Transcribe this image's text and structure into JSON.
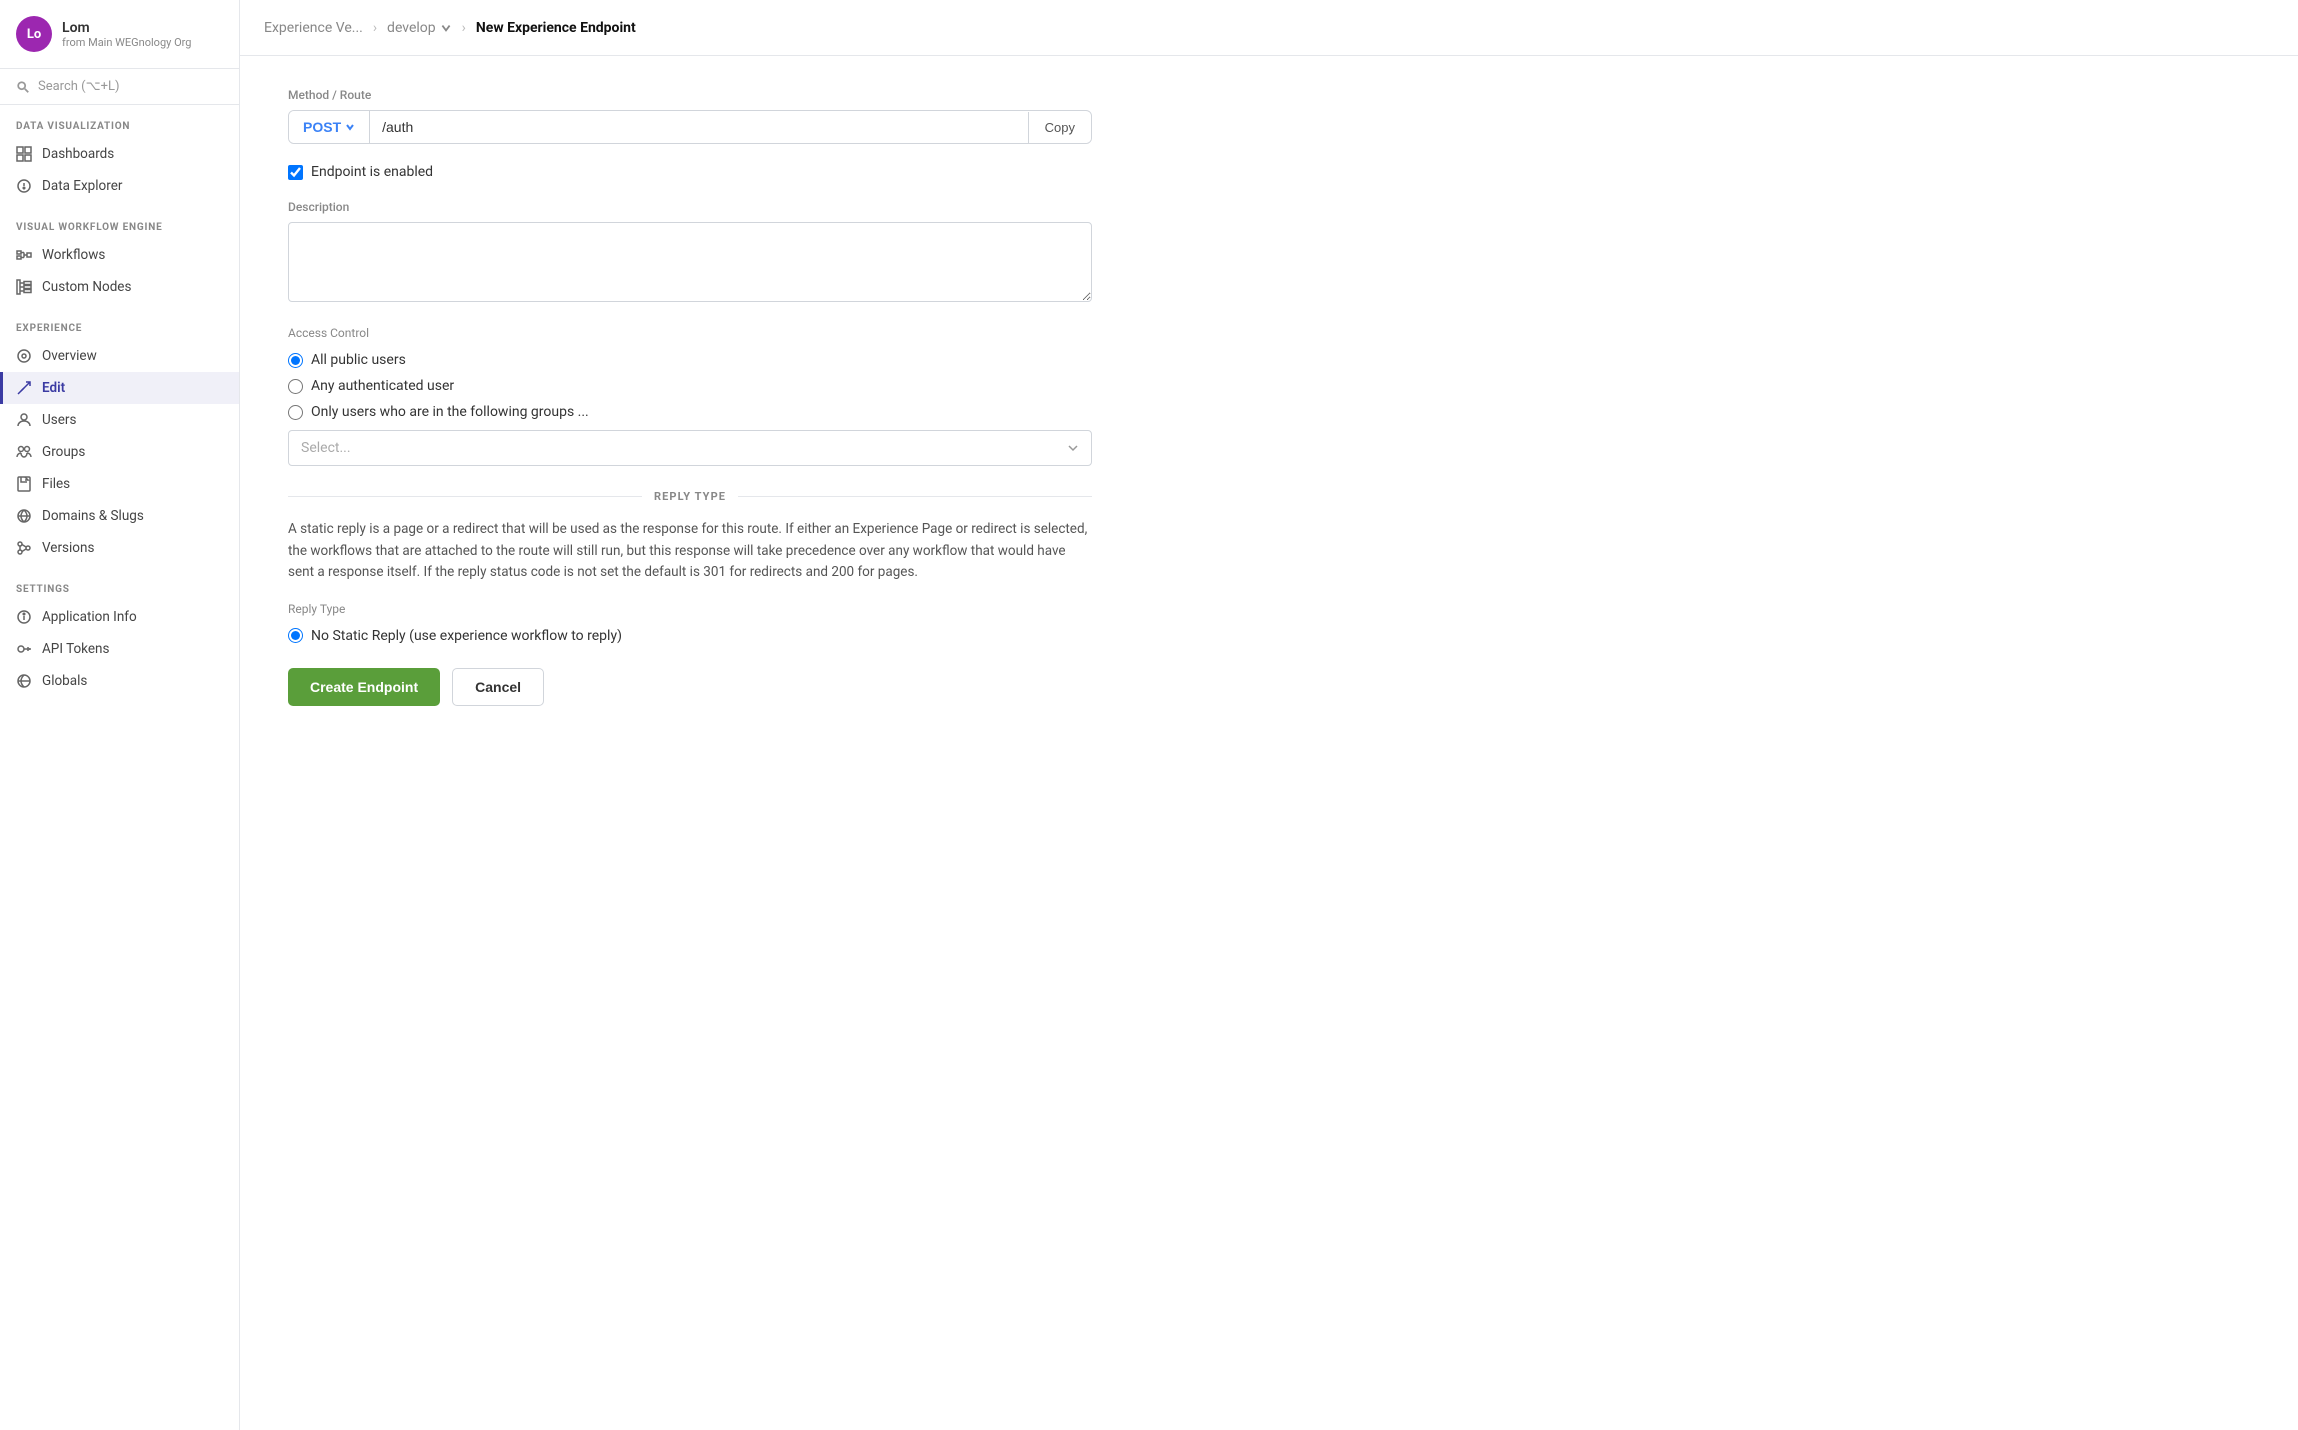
{
  "user": {
    "initials": "Lo",
    "name": "Lom",
    "org": "from Main WEGnology Org"
  },
  "search": {
    "placeholder": "Search (⌥+L)"
  },
  "sidebar": {
    "sections": [
      {
        "label": "DATA VISUALIZATION",
        "items": [
          {
            "id": "dashboards",
            "label": "Dashboards",
            "icon": "grid-icon"
          },
          {
            "id": "data-explorer",
            "label": "Data Explorer",
            "icon": "circle-icon"
          }
        ]
      },
      {
        "label": "VISUAL WORKFLOW ENGINE",
        "items": [
          {
            "id": "workflows",
            "label": "Workflows",
            "icon": "workflow-icon"
          },
          {
            "id": "custom-nodes",
            "label": "Custom Nodes",
            "icon": "nodes-icon"
          }
        ]
      },
      {
        "label": "EXPERIENCE",
        "items": [
          {
            "id": "overview",
            "label": "Overview",
            "icon": "overview-icon"
          },
          {
            "id": "edit",
            "label": "Edit",
            "icon": "edit-icon",
            "active": true
          },
          {
            "id": "users",
            "label": "Users",
            "icon": "users-icon"
          },
          {
            "id": "groups",
            "label": "Groups",
            "icon": "groups-icon"
          },
          {
            "id": "files",
            "label": "Files",
            "icon": "files-icon"
          },
          {
            "id": "domains",
            "label": "Domains & Slugs",
            "icon": "domains-icon"
          },
          {
            "id": "versions",
            "label": "Versions",
            "icon": "versions-icon"
          }
        ]
      },
      {
        "label": "SETTINGS",
        "items": [
          {
            "id": "app-info",
            "label": "Application Info",
            "icon": "app-info-icon"
          },
          {
            "id": "api-tokens",
            "label": "API Tokens",
            "icon": "api-tokens-icon"
          },
          {
            "id": "globals",
            "label": "Globals",
            "icon": "globals-icon"
          }
        ]
      }
    ]
  },
  "breadcrumb": {
    "app": "Experience Ve...",
    "branch": "develop",
    "current": "New Experience Endpoint"
  },
  "form": {
    "method_route_label": "Method / Route",
    "method": "POST",
    "route": "/auth",
    "copy_label": "Copy",
    "endpoint_enabled_label": "Endpoint is enabled",
    "description_label": "Description",
    "description_placeholder": "",
    "access_control_label": "Access Control",
    "access_options": [
      {
        "id": "all-public",
        "label": "All public users",
        "checked": true
      },
      {
        "id": "any-auth",
        "label": "Any authenticated user",
        "checked": false
      },
      {
        "id": "groups",
        "label": "Only users who are in the following groups ...",
        "checked": false
      }
    ],
    "select_placeholder": "Select...",
    "reply_type_section": "REPLY TYPE",
    "reply_type_description": "A static reply is a page or a redirect that will be used as the response for this route. If either an Experience Page or redirect is selected, the workflows that are attached to the route will still run, but this response will take precedence over any workflow that would have sent a response itself. If the reply status code is not set the default is 301 for redirects and 200 for pages.",
    "reply_type_label": "Reply Type",
    "reply_type_options": [
      {
        "id": "no-static",
        "label": "No Static Reply (use experience workflow to reply)",
        "checked": true
      }
    ],
    "create_label": "Create Endpoint",
    "cancel_label": "Cancel"
  }
}
